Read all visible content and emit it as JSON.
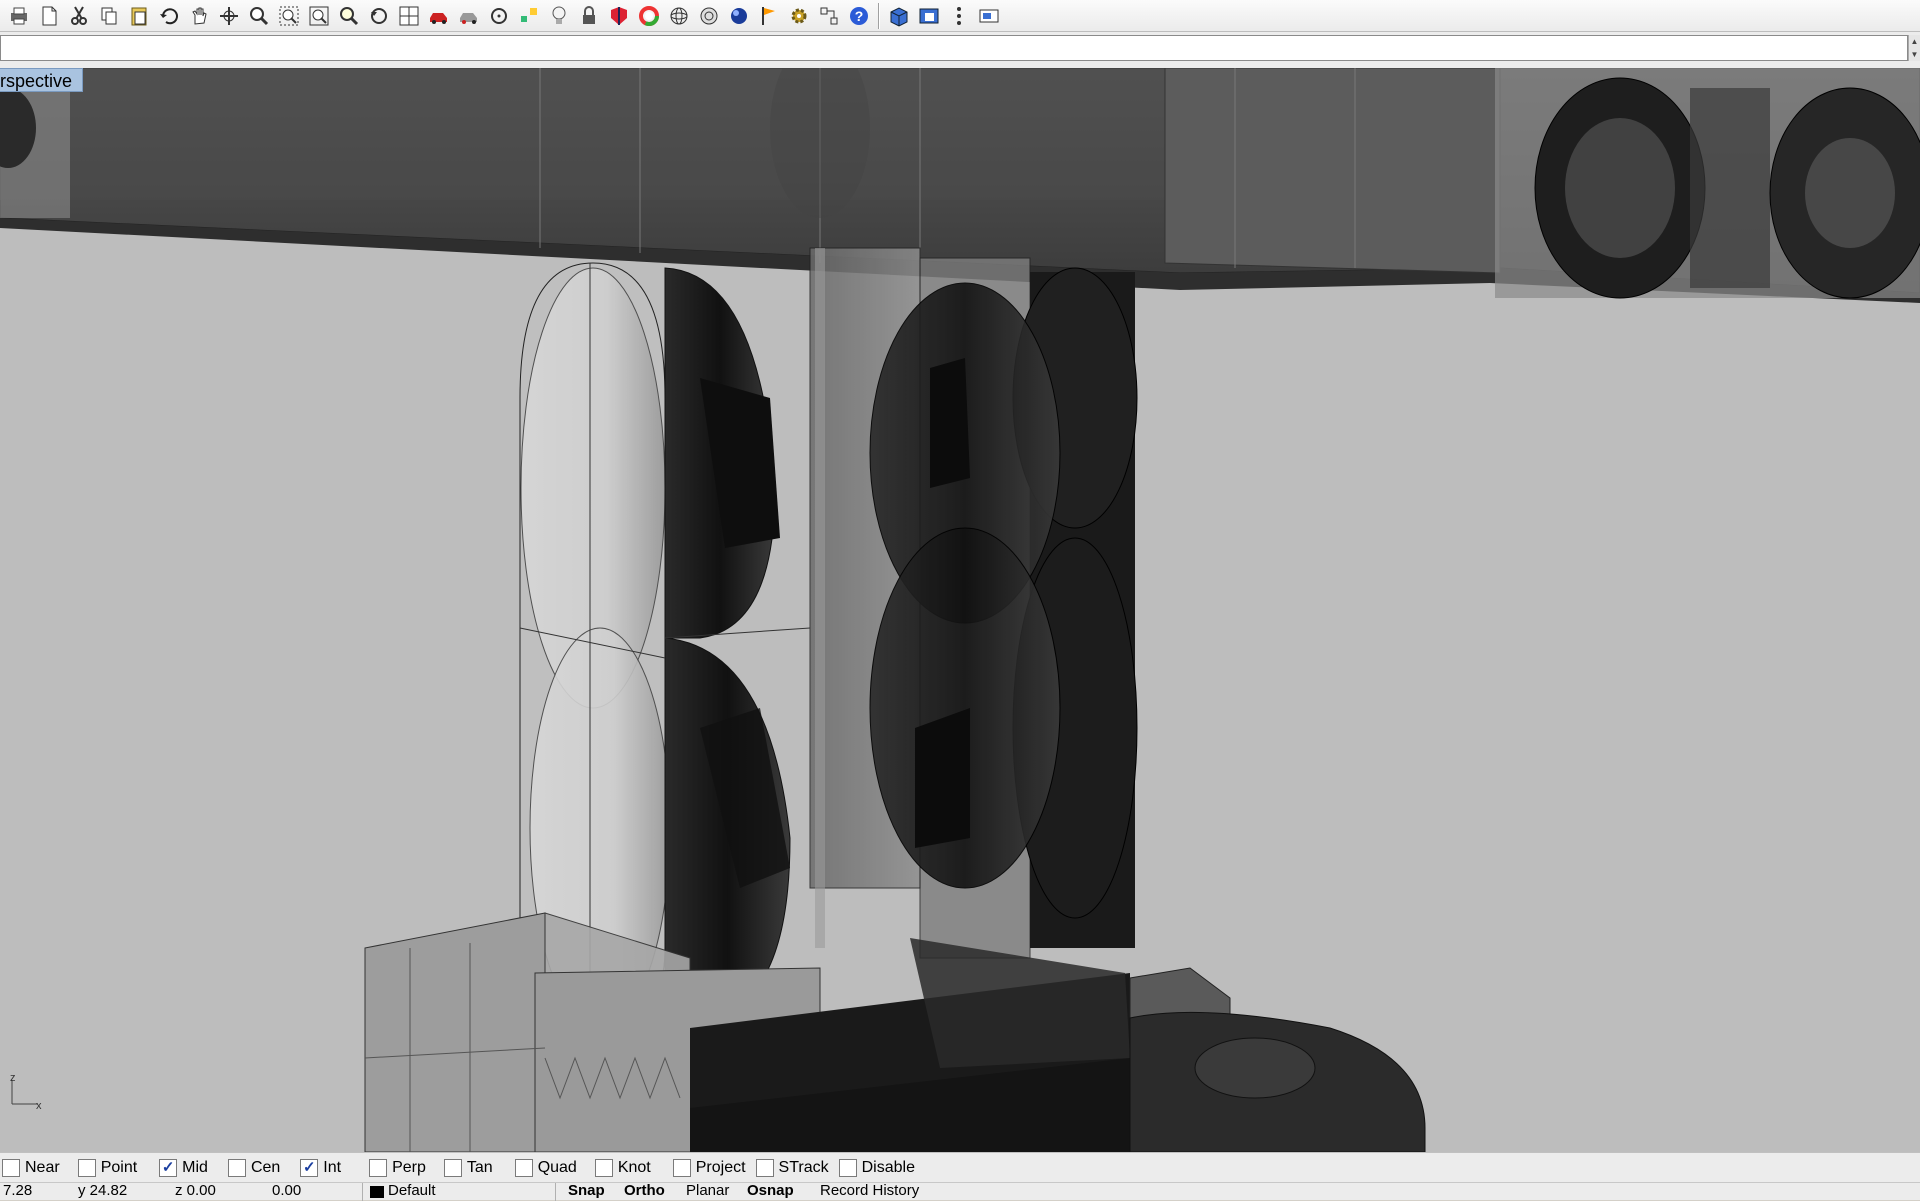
{
  "toolbar": {
    "icons": [
      "print-icon",
      "new-document-icon",
      "cut-icon",
      "copy-icon",
      "paste-icon",
      "undo-icon",
      "pan-icon",
      "rotate-view-icon",
      "zoom-icon",
      "zoom-window-icon",
      "zoom-extents-icon",
      "zoom-selected-icon",
      "undo-view-icon",
      "four-viewports-icon",
      "car-icon",
      "render-preview-icon",
      "circle-icon",
      "point-icon",
      "light-icon",
      "lock-icon",
      "shade-icon",
      "color-wheel-icon",
      "sphere-wire-icon",
      "globe-icon",
      "render-sphere-icon",
      "flag-icon",
      "gear-icon",
      "dimension-icon",
      "help-icon",
      "box-icon",
      "window-icon",
      "more-icon",
      "viewport-layout-icon"
    ]
  },
  "command": {
    "value": ""
  },
  "viewport": {
    "title": "rspective",
    "axis_z": "z",
    "axis_x": "x"
  },
  "osnap": [
    {
      "label": "Near",
      "checked": false
    },
    {
      "label": "Point",
      "checked": false
    },
    {
      "label": "Mid",
      "checked": true
    },
    {
      "label": "Cen",
      "checked": false
    },
    {
      "label": "Int",
      "checked": true
    },
    {
      "label": "Perp",
      "checked": false
    },
    {
      "label": "Tan",
      "checked": false
    },
    {
      "label": "Quad",
      "checked": false
    },
    {
      "label": "Knot",
      "checked": false
    },
    {
      "label": "Project",
      "checked": false
    },
    {
      "label": "STrack",
      "checked": false
    },
    {
      "label": "Disable",
      "checked": false
    }
  ],
  "status": {
    "x": "7.28",
    "y": "y 24.82",
    "z": "z 0.00",
    "d": "0.00",
    "layer": "Default",
    "snap": "Snap",
    "ortho": "Ortho",
    "planar": "Planar",
    "osnap": "Osnap",
    "record_history": "Record History"
  },
  "colors": {
    "viewport_bg": "#bdbdbd",
    "title_bg": "#a9c3e0",
    "check": "#1b3fa0"
  }
}
